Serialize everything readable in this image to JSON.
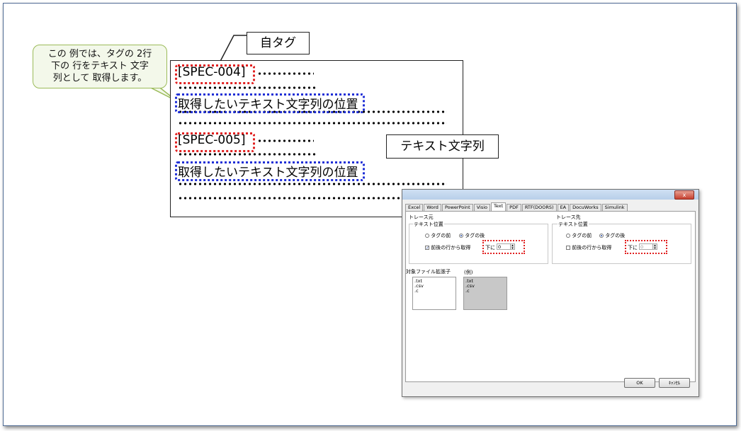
{
  "callout": {
    "lines": [
      "この 例では、タグの 2行",
      "下の 行をテキスト 文字",
      "列として 取得します。"
    ]
  },
  "doc_lines": {
    "tag1": "[SPEC-004]",
    "text1": "取得したいテキスト文字列の位置",
    "tag2": "[SPEC-005]",
    "text2": "取得したいテキスト文字列の位置"
  },
  "labels": {
    "own_tag": "自タグ",
    "text_string": "テキスト文字列"
  },
  "dialog": {
    "close": "x",
    "tabs": [
      "Excel",
      "Word",
      "PowerPoint",
      "Visio",
      "Text",
      "PDF",
      "RTF(DOORS)",
      "EA",
      "DocuWorks",
      "Simulink"
    ],
    "active_tab": "Text",
    "source": {
      "title": "トレース元",
      "group": "テキスト位置",
      "radio_before": "タグの前",
      "radio_after": "タグの後",
      "checkbox": "前後の行から取得",
      "checked": true,
      "down_label": "下に",
      "down_value": "0"
    },
    "target": {
      "title": "トレース先",
      "group": "テキスト位置",
      "radio_before": "タグの前",
      "radio_after": "タグの後",
      "checkbox": "前後の行から取得",
      "checked": false,
      "down_label": "下に",
      "down_value": "0"
    },
    "ext_label": "対象ファイル拡張子",
    "example_label": "(例)",
    "extensions": [
      ".txt",
      ".csv",
      ".c"
    ],
    "example_extensions": [
      ".txt",
      ".csv",
      ".c"
    ],
    "ok": "OK",
    "cancel": "ｷｬﾝｾﾙ"
  }
}
